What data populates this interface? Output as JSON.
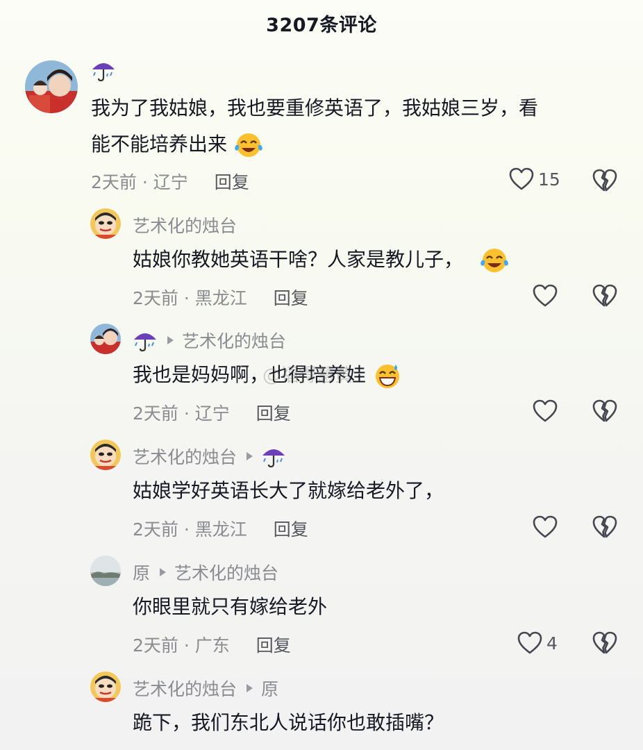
{
  "header": {
    "title": "3207条评论"
  },
  "watermark": "@福得慧黄",
  "comments": [
    {
      "name": "☔",
      "text_line1": "我为了我姑娘，我也要重修英语了，我姑娘三岁，看",
      "text_line2": "能不能培养出来",
      "time_location": "2天前 · 辽宁",
      "reply_label": "回复",
      "like_count": "15"
    },
    {
      "name": "艺术化的烛台",
      "text": "姑娘你教她英语干啥？人家是教儿子，",
      "time_location": "2天前 · 黑龙江",
      "reply_label": "回复"
    },
    {
      "name": "☔",
      "reply_to": "艺术化的烛台",
      "text": "我也是妈妈啊，也得培养娃",
      "time_location": "2天前 · 辽宁",
      "reply_label": "回复"
    },
    {
      "name": "艺术化的烛台",
      "reply_to": "☔",
      "text": "姑娘学好英语长大了就嫁给老外了，",
      "time_location": "2天前 · 黑龙江",
      "reply_label": "回复"
    },
    {
      "name": "原",
      "reply_to": "艺术化的烛台",
      "text": "你眼里就只有嫁给老外",
      "time_location": "2天前 · 广东",
      "reply_label": "回复",
      "like_count": "4"
    },
    {
      "name": "艺术化的烛台",
      "reply_to": "原",
      "text": "跪下，我们东北人说话你也敢插嘴？"
    }
  ],
  "icons": {
    "like": "heart-outline-icon",
    "dislike": "broken-heart-icon",
    "arrow": "reply-arrow-icon"
  },
  "colors": {
    "text": "#161823",
    "secondary": "#8a8b91",
    "reply": "#56575e"
  }
}
